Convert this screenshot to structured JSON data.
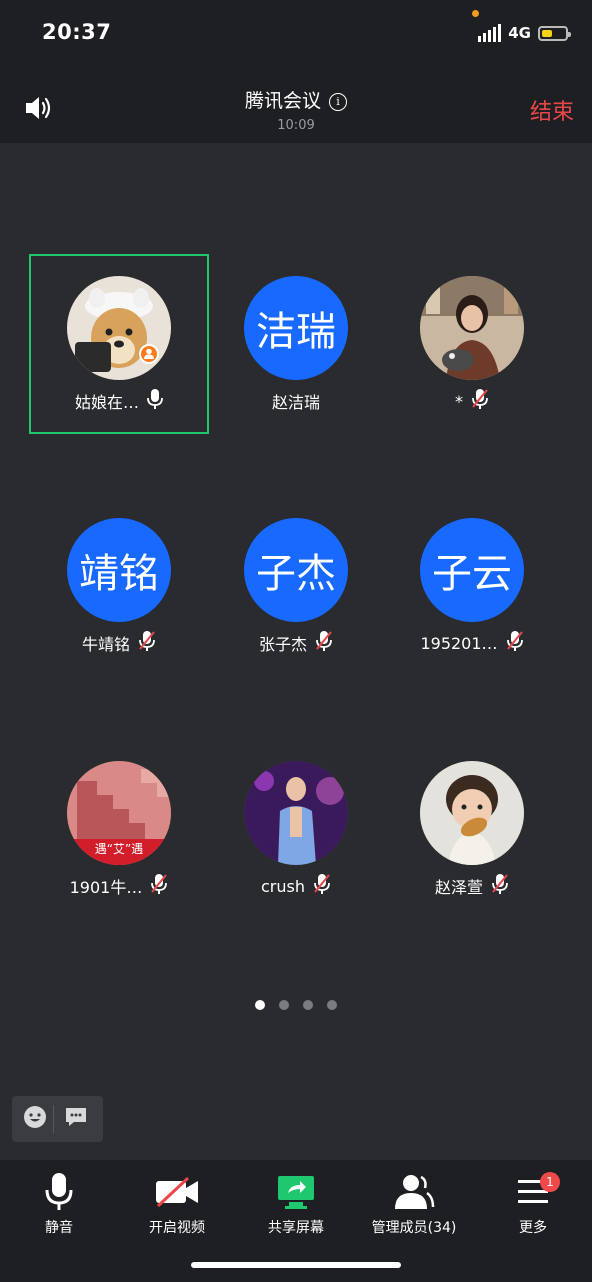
{
  "status": {
    "time": "20:37",
    "network": "4G",
    "battery_level": 0.45
  },
  "header": {
    "title": "腾讯会议",
    "elapsed": "10:09",
    "end_label": "结束"
  },
  "participants": [
    {
      "name": "姑娘在…",
      "avatar_text": "",
      "photo": "dog",
      "mic": "on",
      "active": true,
      "host": true
    },
    {
      "name": "赵洁瑞",
      "avatar_text": "洁瑞",
      "mic": "none"
    },
    {
      "name": "*",
      "avatar_text": "",
      "photo": "girl-with-dog",
      "mic": "muted"
    },
    {
      "name": "牛靖铭",
      "avatar_text": "靖铭",
      "mic": "muted"
    },
    {
      "name": "张子杰",
      "avatar_text": "子杰",
      "mic": "muted"
    },
    {
      "name": "195201…",
      "avatar_text": "子云",
      "mic": "muted"
    },
    {
      "name": "1901牛…",
      "avatar_text": "",
      "photo": "red-stairs",
      "photo_caption": "遇“艾”遇",
      "mic": "muted"
    },
    {
      "name": "crush",
      "avatar_text": "",
      "photo": "singer",
      "mic": "muted"
    },
    {
      "name": "赵泽萱",
      "avatar_text": "",
      "photo": "child",
      "mic": "muted"
    }
  ],
  "pagination": {
    "pages": 4,
    "current": 1
  },
  "toolbar": {
    "mute": "静音",
    "video": "开启视频",
    "share": "共享屏幕",
    "members": "管理成员(34)",
    "more": "更多",
    "more_badge": "1"
  },
  "colors": {
    "accent_blue": "#1769FF",
    "end_red": "#E8474A",
    "active_green": "#1FC76F",
    "share_green": "#1FC76F"
  }
}
